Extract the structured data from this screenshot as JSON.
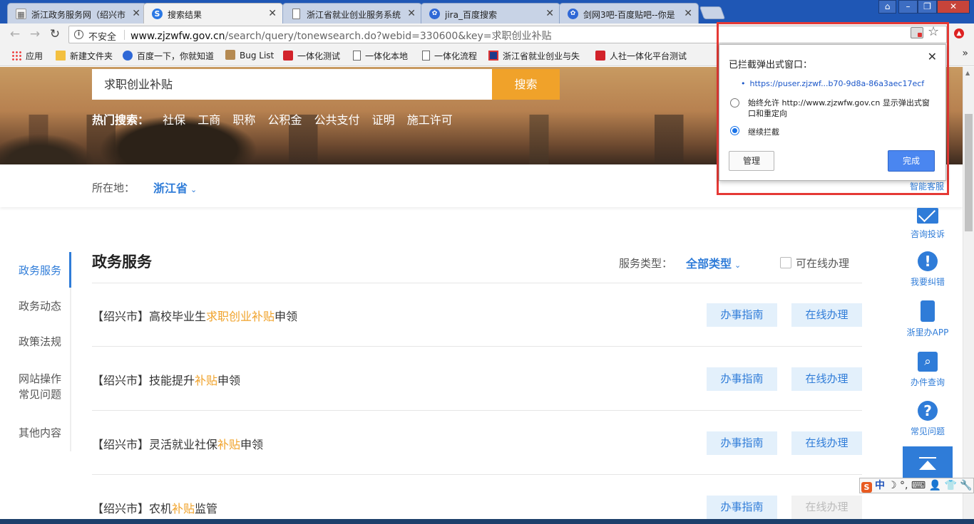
{
  "browser": {
    "tabs": [
      {
        "title": "浙江政务服务网（绍兴市",
        "favicon": "zj-gov-icon"
      },
      {
        "title": "搜索结果",
        "favicon": "search-result-icon",
        "active": true
      },
      {
        "title": "浙江省就业创业服务系统",
        "favicon": "page-icon"
      },
      {
        "title": "jira_百度搜索",
        "favicon": "baidu-paw-icon"
      },
      {
        "title": "剑网3吧-百度贴吧--你是",
        "favicon": "baidu-paw-icon"
      }
    ],
    "close_glyph": "✕",
    "address": {
      "security_text": "不安全",
      "host": "www.zjzwfw.gov.cn",
      "path": "/search/query/tonewsearch.do?webid=330600&key=求职创业补贴"
    },
    "bookmarks": [
      {
        "label": "应用",
        "icon": "apps-icon"
      },
      {
        "label": "新建文件夹",
        "icon": "folder-icon"
      },
      {
        "label": "百度一下，你就知道",
        "icon": "baidu-paw-icon"
      },
      {
        "label": "Bug List",
        "icon": "bug-icon"
      },
      {
        "label": "一体化测试",
        "icon": "red-logo-icon"
      },
      {
        "label": "一体化本地",
        "icon": "page-icon"
      },
      {
        "label": "一体化流程",
        "icon": "page-icon"
      },
      {
        "label": "浙江省就业创业与失",
        "icon": "fb-icon"
      },
      {
        "label": "人社一体化平台测试",
        "icon": "red-logo-icon"
      }
    ],
    "bookmarks_more": "»"
  },
  "popup_bubble": {
    "title": "已拦截弹出式窗口：",
    "blocked_url": "https://puser.zjzwf...b70-9d8a-86a3aec17ecf",
    "option_allow": "始终允许 http://www.zjzwfw.gov.cn 显示弹出式窗口和重定向",
    "option_block": "继续拦截",
    "selected": "option_block",
    "manage_label": "管理",
    "done_label": "完成",
    "close_glyph": "✕"
  },
  "page": {
    "search": {
      "query": "求职创业补贴",
      "button": "搜索"
    },
    "hot": {
      "label": "热门搜索：",
      "items": [
        "社保",
        "工商",
        "职称",
        "公积金",
        "公共支付",
        "证明",
        "施工许可"
      ]
    },
    "location": {
      "label": "所在地：",
      "value": "浙江省",
      "chevron": "⌄"
    },
    "leftnav": [
      {
        "label": "政务服务",
        "active": true
      },
      {
        "label": "政务动态"
      },
      {
        "label": "政策法规"
      },
      {
        "label": "网站操作\n常见问题"
      },
      {
        "label": "其他内容"
      }
    ],
    "section": {
      "title": "政务服务",
      "type_label": "服务类型：",
      "type_value": "全部类型",
      "online_label": "可在线办理"
    },
    "results": [
      {
        "prefix": "【绍兴市】高校毕业生",
        "hl": "求职创业补贴",
        "suffix": "申领",
        "guide": "办事指南",
        "online": "在线办理",
        "online_enabled": true
      },
      {
        "prefix": "【绍兴市】技能提升",
        "hl": "补贴",
        "suffix": "申领",
        "guide": "办事指南",
        "online": "在线办理",
        "online_enabled": true
      },
      {
        "prefix": "【绍兴市】灵活就业社保",
        "hl": "补贴",
        "suffix": "申领",
        "guide": "办事指南",
        "online": "在线办理",
        "online_enabled": true
      },
      {
        "prefix": "【绍兴市】农机",
        "hl": "补贴",
        "suffix": "监管",
        "guide": "办事指南",
        "online": "在线办理",
        "online_enabled": false
      }
    ],
    "float_bar": {
      "smart_service": "智能客服",
      "items": [
        {
          "label": "咨询投诉",
          "icon": "mail-icon"
        },
        {
          "label": "我要纠错",
          "icon": "alert-icon",
          "glyph": "!"
        },
        {
          "label": "浙里办APP",
          "icon": "phone-icon"
        },
        {
          "label": "办件查询",
          "icon": "search-icon",
          "glyph": "⌕"
        },
        {
          "label": "常见问题",
          "icon": "help-icon",
          "glyph": "?"
        }
      ]
    }
  },
  "ime": {
    "logo": "S",
    "mode": "中",
    "glyphs": "☽ °, ⌨ 👤 👕 🔧"
  },
  "colors": {
    "accent": "#2f7cd8",
    "highlight": "#f0a22a",
    "tabstrip": "#1f57b5",
    "alert_frame": "#e53935"
  }
}
